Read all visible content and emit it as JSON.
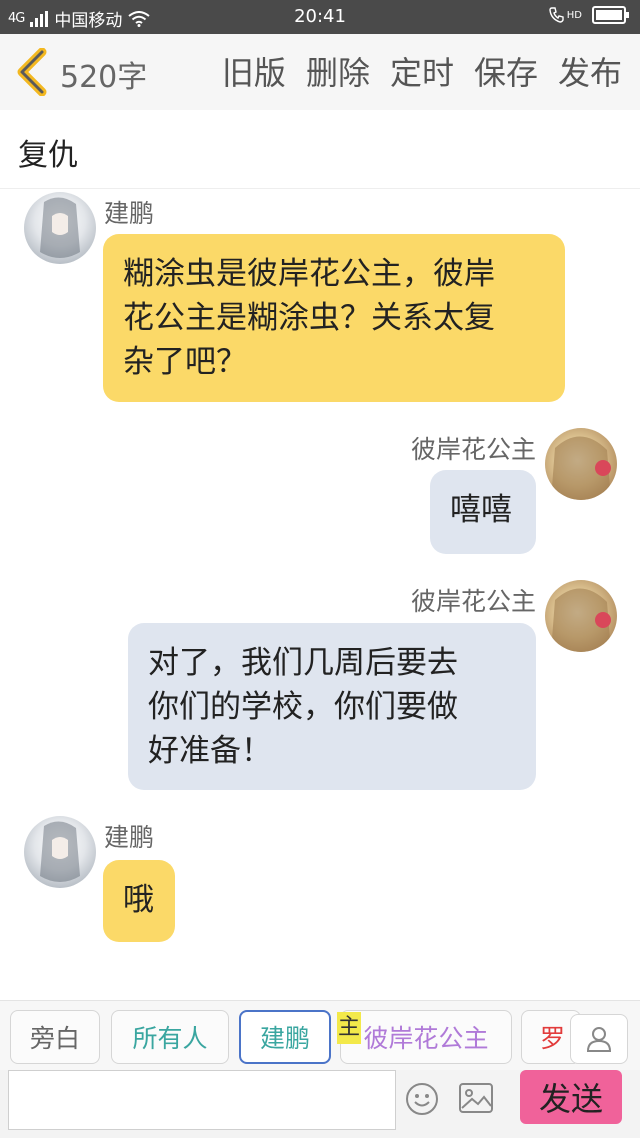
{
  "status_bar": {
    "network": "4G",
    "carrier": "中国移动",
    "time": "20:41",
    "call_icon_label": "HD"
  },
  "toolbar": {
    "word_count": "520字",
    "actions": [
      "旧版",
      "删除",
      "定时",
      "保存",
      "发布"
    ]
  },
  "story": {
    "title": "复仇"
  },
  "messages": [
    {
      "sender": "建鹏",
      "side": "left",
      "text_lines": [
        "糊涂虫是彼岸花公主，彼岸",
        "花公主是糊涂虫？关系太复",
        "杂了吧？"
      ]
    },
    {
      "sender": "彼岸花公主",
      "side": "right",
      "text_lines": [
        "嘻嘻"
      ]
    },
    {
      "sender": "彼岸花公主",
      "side": "right",
      "text_lines": [
        "对了，我们几周后要去",
        "你们的学校，你们要做",
        "好准备！"
      ]
    },
    {
      "sender": "建鹏",
      "side": "left",
      "text_lines": [
        "哦"
      ]
    }
  ],
  "roles": [
    {
      "label": "旁白",
      "color": "#666666"
    },
    {
      "label": "所有人",
      "color": "#3aa6a0"
    },
    {
      "label": "建鹏",
      "color": "#3aa6a0"
    },
    {
      "label": "彼岸花公主",
      "color": "#b07ad8"
    },
    {
      "label": "罗",
      "color": "#e23b3b"
    }
  ],
  "host_tag": "主",
  "input": {
    "value": "",
    "placeholder": ""
  },
  "send_label": "发送",
  "colors": {
    "left_bubble": "#fbd968",
    "right_bubble": "#dfe5ef",
    "send_button": "#f0629a",
    "active_chip_border": "#4b74c8"
  }
}
